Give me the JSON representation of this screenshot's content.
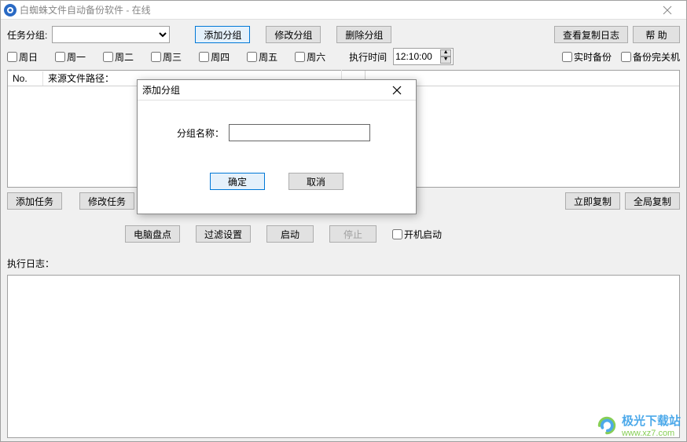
{
  "window": {
    "title": "白蜘蛛文件自动备份软件 - 在线"
  },
  "toolbar": {
    "task_group_label": "任务分组:",
    "task_group_value": "",
    "add_group_btn": "添加分组",
    "modify_group_btn": "修改分组",
    "delete_group_btn": "删除分组",
    "view_log_btn": "查看复制日志",
    "help_btn": "帮 助"
  },
  "days": {
    "sun": "周日",
    "mon": "周一",
    "tue": "周二",
    "wed": "周三",
    "thu": "周四",
    "fri": "周五",
    "sat": "周六",
    "exec_time_label": "执行时间",
    "exec_time_value": "12:10:00",
    "realtime_backup": "实时备份",
    "shutdown_after": "备份完关机"
  },
  "list": {
    "col_no": "No.",
    "col_source": "来源文件路径："
  },
  "task_buttons": {
    "add_task": "添加任务",
    "modify_task": "修改任务",
    "copy_now": "立即复制",
    "global_copy": "全局复制"
  },
  "mid_buttons": {
    "inventory": "电脑盘点",
    "filter": "过滤设置",
    "start": "启动",
    "stop": "停止",
    "autostart": "开机启动"
  },
  "log": {
    "label": "执行日志："
  },
  "modal": {
    "title": "添加分组",
    "name_label": "分组名称：",
    "name_value": "",
    "ok_btn": "确定",
    "cancel_btn": "取消"
  },
  "watermark": {
    "name": "极光下载站",
    "url": "www.xz7.com"
  }
}
